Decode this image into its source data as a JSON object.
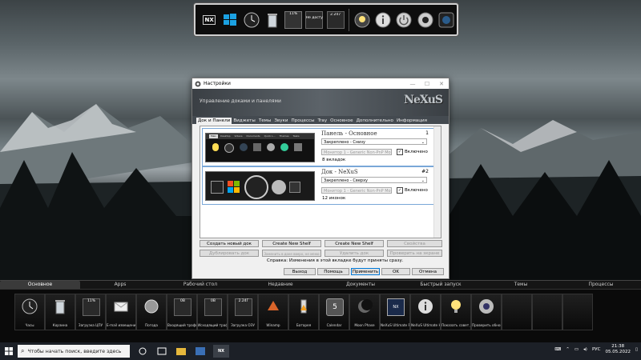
{
  "top_dock": {
    "items": [
      {
        "icon": "nexus-logo-icon",
        "label": ""
      },
      {
        "icon": "windows-start-icon",
        "label": ""
      },
      {
        "icon": "clock-icon",
        "label": ""
      },
      {
        "icon": "recycle-bin-icon",
        "label": ""
      },
      {
        "icon": "cpu-meter-icon",
        "label": "11%"
      },
      {
        "icon": "weather-icon",
        "label": "Не досту"
      },
      {
        "icon": "network-meter-icon",
        "label": "2.247"
      },
      {
        "icon": "lightbulb-icon",
        "label": ""
      },
      {
        "icon": "info-icon",
        "label": ""
      },
      {
        "icon": "power-icon",
        "label": ""
      },
      {
        "icon": "webcam-icon",
        "label": ""
      },
      {
        "icon": "camera-icon",
        "label": ""
      }
    ]
  },
  "window": {
    "title": "Настройки",
    "banner_title": "Управление доками и панелями",
    "logo": "NeXuS",
    "tabs": [
      "Док и Панели",
      "Виджеты",
      "Темы",
      "Звуки",
      "Процессы",
      "Tray",
      "Основное",
      "Дополнительно",
      "Информация"
    ],
    "active_tab": 0,
    "items": [
      {
        "title": "Панель - Основное",
        "number": "1",
        "position": "Закреплено - Снизу",
        "monitor": "Монитор 1 - Generic Non-PnP Mo",
        "enabled_label": "Включено",
        "enabled": true,
        "count": "8 вкладок",
        "preview_tabs": [
          "Main",
          "Desktop",
          "Videos",
          "Documents",
          "Quick L...",
          "Themes",
          "Tasks"
        ]
      },
      {
        "title": "Док - NeXuS",
        "number": "#2",
        "position": "Закреплено - Сверху",
        "monitor": "Монитор 1 - Generic Non-PnP Mo",
        "enabled_label": "Включено",
        "enabled": true,
        "count": "12 иконок"
      }
    ],
    "buttons_row1": [
      "Создать новый док",
      "Create New Shelf",
      "Create New Shelf",
      "Свойства"
    ],
    "buttons_row2": [
      "Дублировать док",
      "Заменить в доке вверх, не меню",
      "Удалить док",
      "Проверить на экране"
    ],
    "help_text": "Справка: Изменения в этой вкладке будут приняты сразу.",
    "footer_buttons": [
      "Выход",
      "Помощь",
      "Применить",
      "OK",
      "Отмена"
    ]
  },
  "shelf": {
    "tabs": [
      "Основное",
      "Apps",
      "Рабочий стол",
      "Недавние",
      "Документы",
      "Быстрый запуск",
      "Темы",
      "Процессы"
    ],
    "active_tab": 0,
    "items": [
      {
        "icon": "clock-icon",
        "label": "Часы",
        "value": ""
      },
      {
        "icon": "recycle-bin-icon",
        "label": "Корзина",
        "value": ""
      },
      {
        "icon": "cpu-meter-icon",
        "label": "Загрузка ЦПУ",
        "value": "11%"
      },
      {
        "icon": "email-icon",
        "label": "E-mail извещение",
        "value": ""
      },
      {
        "icon": "weather-icon",
        "label": "Погода",
        "value": ""
      },
      {
        "icon": "network-in-icon",
        "label": "Входящий трафик",
        "value": "0B"
      },
      {
        "icon": "network-out-icon",
        "label": "Исходящий трафик",
        "value": "0B"
      },
      {
        "icon": "ram-meter-icon",
        "label": "Загрузка ОЗУ",
        "value": "2.24Г"
      },
      {
        "icon": "winamp-icon",
        "label": "Winamp",
        "value": ""
      },
      {
        "icon": "battery-icon",
        "label": "Батарея",
        "value": ""
      },
      {
        "icon": "calendar-icon",
        "label": "Calendar",
        "value": "5"
      },
      {
        "icon": "moon-phase-icon",
        "label": "Moon Phase",
        "value": ""
      },
      {
        "icon": "nexus-logo-icon",
        "label": "NeXuS Ultimate Pr",
        "value": ""
      },
      {
        "icon": "info-icon",
        "label": "NeXuS Ultimate H",
        "value": ""
      },
      {
        "icon": "lightbulb-icon",
        "label": "Показать совет д",
        "value": ""
      },
      {
        "icon": "webcam-icon",
        "label": "Проверить обнов",
        "value": ""
      }
    ]
  },
  "taskbar": {
    "search_placeholder": "Чтобы начать поиск, введите здесь",
    "language": "РУС",
    "time": "21:38",
    "date": "05.05.2022"
  },
  "colors": {
    "accent": "#0078d7",
    "banner": "#4a5157",
    "shelf_bg": "#0a0a0a"
  }
}
